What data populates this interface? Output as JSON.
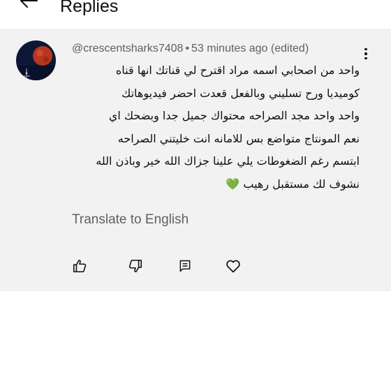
{
  "header": {
    "title": "Replies",
    "back_icon": "arrow-left-icon"
  },
  "comment": {
    "username": "@crescentsharks7408",
    "separator": "•",
    "time": "53 minutes ago (edited)",
    "lines": [
      "واحد من اصحابي اسمه مراد اقترح لي قناتك انها قناه",
      "كوميديا ورح تسليني وبالفعل قعدت احضر فيديوهاتك",
      "واحد واحد مجد الصراحه محتواك جميل جدا وبضحك اي",
      "نعم المونتاج متواضع بس للامانه  انت خليتني الصراحه",
      "ابتسم  رغم الضغوطات يلي علينا جزاك الله خير وباذن الله",
      "نشوف لك مستقبل رهيب"
    ],
    "emoji": "💚",
    "translate_label": "Translate to English",
    "menu_icon": "more-vertical-icon",
    "actions": [
      "like-icon",
      "dislike-icon",
      "reply-icon",
      "heart-icon"
    ]
  },
  "colors": {
    "background": "#ffffff",
    "comment_bg": "#f2f2f2",
    "secondary_text": "#606060",
    "primary_text": "#0f0f0f",
    "emoji_green": "#7cc243"
  }
}
